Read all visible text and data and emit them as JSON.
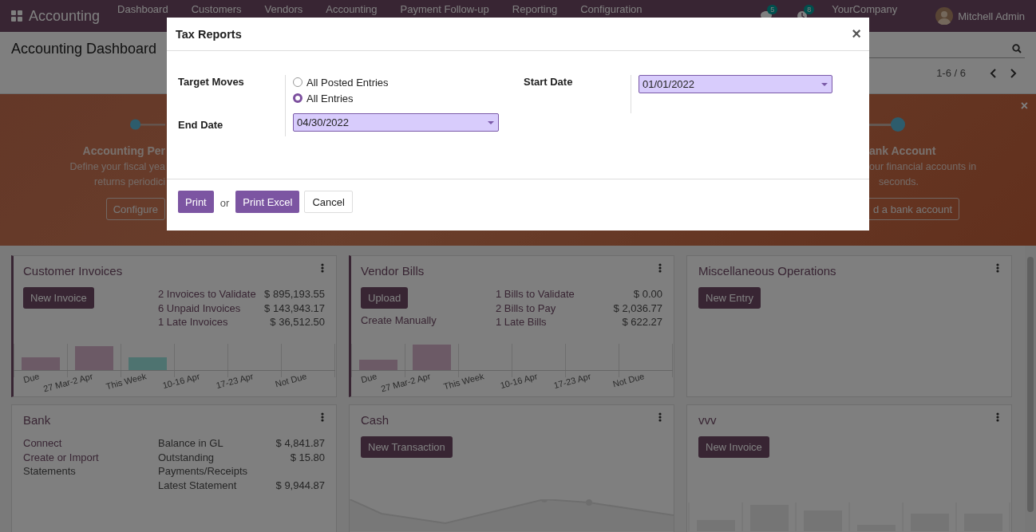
{
  "navbar": {
    "app": "Accounting",
    "menu": [
      "Dashboard",
      "Customers",
      "Vendors",
      "Accounting",
      "Payment Follow-up",
      "Reporting",
      "Configuration"
    ],
    "messages_count": "5",
    "activities_count": "8",
    "company": "YourCompany",
    "user": "Mitchell Admin"
  },
  "control_panel": {
    "title": "Accounting Dashboard",
    "pager": "1-6 / 6"
  },
  "onboarding": {
    "close": "×",
    "steps": [
      {
        "title": "Accounting Per",
        "lines": [
          "Define your fiscal yea",
          "returns periodici"
        ],
        "button": "Configure"
      },
      {
        "title": "ank Account",
        "lines": [
          "our financial accounts in",
          "seconds."
        ],
        "button": "d a bank account"
      }
    ]
  },
  "cards": [
    {
      "title": "Customer Invoices",
      "highlighted": true,
      "buttons": [
        "New Invoice"
      ],
      "stats": [
        {
          "label": "2 Invoices to Validate",
          "amount": "$ 895,193.55",
          "kind": "link"
        },
        {
          "label": "6 Unpaid Invoices",
          "amount": "$ 143,943.17",
          "kind": "link"
        },
        {
          "label": "1 Late Invoices",
          "amount": "$ 36,512.50",
          "kind": "link"
        }
      ],
      "graph": {
        "kind": "labeled_bars",
        "labels": [
          "Due",
          "27 Mar-2 Apr",
          "This Week",
          "10-16 Apr",
          "17-23 Apr",
          "Not Due"
        ]
      }
    },
    {
      "title": "Vendor Bills",
      "highlighted": true,
      "buttons": [
        "Upload"
      ],
      "links": [
        {
          "text": "Create Manually",
          "kind": "link"
        }
      ],
      "stats": [
        {
          "label": "1 Bills to Validate",
          "amount": "$ 0.00",
          "kind": "link"
        },
        {
          "label": "2 Bills to Pay",
          "amount": "$ 2,036.77",
          "kind": "link"
        },
        {
          "label": "1 Late Bills",
          "amount": "$ 622.27",
          "kind": "link"
        }
      ],
      "graph": {
        "kind": "labeled_bars",
        "labels": [
          "Due",
          "27 Mar-2 Apr",
          "This Week",
          "10-16 Apr",
          "17-23 Apr",
          "Not Due"
        ]
      }
    },
    {
      "title": "Miscellaneous Operations",
      "highlighted": false,
      "buttons": [
        "New Entry"
      ]
    },
    {
      "title": "Bank",
      "highlighted": false,
      "links": [
        {
          "text": "Connect",
          "kind": "link"
        },
        {
          "text": "Create or Import",
          "kind": "link"
        },
        {
          "text": "Statements",
          "kind": "text"
        }
      ],
      "stats": [
        {
          "label": "Balance in GL",
          "amount": "$ 4,841.87",
          "kind": "text"
        },
        {
          "label": "Outstanding Payments/Receipts",
          "amount": "$ 15.80",
          "kind": "text"
        },
        {
          "label": "Latest Statement",
          "amount": "$ 9,944.87",
          "kind": "text"
        }
      ]
    },
    {
      "title": "Cash",
      "highlighted": false,
      "buttons": [
        "New Transaction"
      ],
      "graph": {
        "kind": "line"
      }
    },
    {
      "title": "vvv",
      "highlighted": false,
      "buttons": [
        "New Invoice"
      ],
      "graph": {
        "kind": "bars"
      }
    }
  ],
  "dialog": {
    "title": "Tax Reports",
    "close": "×",
    "target_moves": {
      "label": "Target Moves",
      "options": [
        {
          "label": "All Posted Entries",
          "selected": false
        },
        {
          "label": "All Entries",
          "selected": true
        }
      ]
    },
    "end_date": {
      "label": "End Date",
      "value": "04/30/2022"
    },
    "start_date": {
      "label": "Start Date",
      "value": "01/01/2022"
    },
    "footer": [
      {
        "kind": "primary",
        "label": "Print"
      },
      {
        "kind": "text",
        "label": "or"
      },
      {
        "kind": "primary",
        "label": "Print Excel"
      },
      {
        "kind": "secondary",
        "label": "Cancel"
      }
    ]
  }
}
